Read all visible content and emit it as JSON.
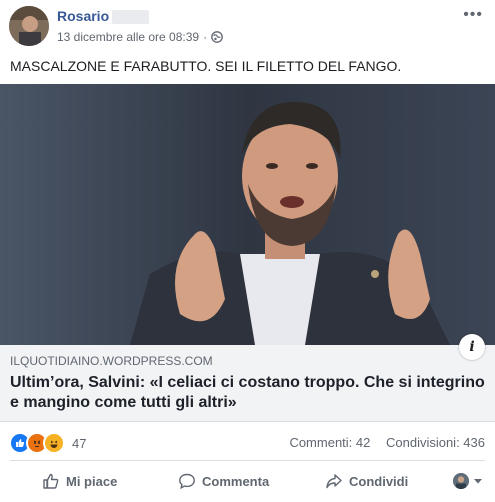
{
  "post": {
    "author": "Rosario",
    "timestamp": "13 dicembre alle ore 08:39",
    "separator": "·",
    "privacy_icon": "globe-icon",
    "more_label": "•••",
    "text": "MASCALZONE E FARABUTTO. SEI IL FILETTO DEL FANGO."
  },
  "link": {
    "domain": "ILQUOTIDIAINO.WORDPRESS.COM",
    "title": "Ultim’ora, Salvini: «I celiaci ci costano troppo. Che si integrino e mangino come tutti gli altri»",
    "info_label": "i"
  },
  "stats": {
    "reaction_icons": [
      "like-icon",
      "angry-icon",
      "haha-icon"
    ],
    "reaction_count": "47",
    "comments": "Commenti: 42",
    "shares": "Condivisioni: 436"
  },
  "actions": {
    "like": "Mi piace",
    "comment": "Commenta",
    "share": "Condividi"
  },
  "colors": {
    "accent": "#385898",
    "like_blue": "#1877f2",
    "angry": "#e9710f",
    "haha": "#f7b125",
    "link_bg": "#f2f3f5"
  }
}
